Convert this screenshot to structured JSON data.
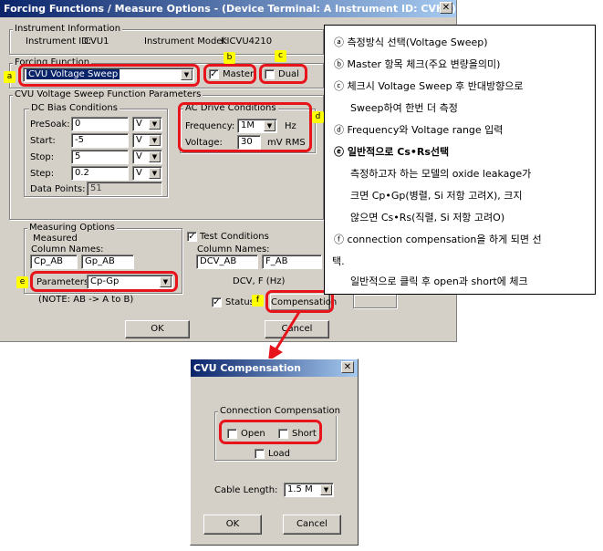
{
  "main_window": {
    "title": "Forcing Functions / Measure Options - (Device Terminal: A  Instrument ID: CVH1)",
    "close_glyph": "✕",
    "instrument_info": {
      "group_label": "Instrument Information",
      "id_label": "Instrument ID:",
      "id_value": "CVU1",
      "model_label": "Instrument Model:",
      "model_value": "KICVU4210"
    },
    "forcing_function": {
      "group_label": "Forcing Function",
      "selected": "CVU Voltage Sweep",
      "master_label": "Master",
      "master_checked": true,
      "dual_label": "Dual",
      "dual_checked": false
    },
    "params_group_label": "CVU Voltage Sweep Function Parameters",
    "dc_bias": {
      "group_label": "DC Bias Conditions",
      "rows": [
        {
          "label": "PreSoak:",
          "value": "0",
          "unit": "V"
        },
        {
          "label": "Start:",
          "value": "-5",
          "unit": "V"
        },
        {
          "label": "Stop:",
          "value": "5",
          "unit": "V"
        },
        {
          "label": "Step:",
          "value": "0.2",
          "unit": "V"
        }
      ],
      "points_label": "Data Points:",
      "points_value": "51"
    },
    "ac_drive": {
      "group_label": "AC Drive Conditions",
      "freq_label": "Frequency:",
      "freq_value": "1M",
      "freq_unit": "Hz",
      "volt_label": "Voltage:",
      "volt_value": "30",
      "volt_unit": "mV RMS"
    },
    "measuring": {
      "group_label": "Measuring Options",
      "measured_label": "Measured",
      "column_names_label": "Column Names:",
      "col1": "Cp_AB",
      "col2": "Gp_AB",
      "parameters_label": "Parameters:",
      "parameters_value": "Cp-Gp",
      "note": "(NOTE: AB -> A to B)"
    },
    "test_conditions": {
      "label": "Test Conditions",
      "checked": true,
      "column_names_label": "Column Names:",
      "col1": "DCV_AB",
      "col2": "F_AB",
      "units_text": "DCV, F (Hz)"
    },
    "status_label": "Status",
    "status_checked": true,
    "compensation_button": "Compensation",
    "ok_button": "OK",
    "cancel_button": "Cancel"
  },
  "markers": {
    "a": "a",
    "b": "b",
    "c": "c",
    "d": "d",
    "e": "e",
    "f": "f"
  },
  "notes": [
    "ⓐ  측정방식 선택(Voltage Sweep)",
    "ⓑ  Master 항목 체크(주요 변량을의미)",
    "ⓒ  체크시 Voltage Sweep 후 반대방향으로",
    "Sweep하여 한번 더 측정",
    "ⓓ  Frequency와 Voltage range 입력",
    "ⓔ  일반적으로 Cs•Rs선택",
    "측정하고자 하는 모델의 oxide leakage가",
    "크면 Cp•Gp(병렬, Si 저항 고려X), 크지",
    "않으면 Cs•Rs(직렬, Si 저항 고려O)",
    "ⓕ  connection compensation을 하게 되면 선",
    "택.",
    "일반적으로 클릭 후 open과 short에 체크"
  ],
  "compensation_dialog": {
    "title": "CVU Compensation",
    "close_glyph": "✕",
    "group_label": "Connection Compensation",
    "open_label": "Open",
    "short_label": "Short",
    "load_label": "Load",
    "cable_label": "Cable Length:",
    "cable_value": "1.5 M",
    "ok_button": "OK",
    "cancel_button": "Cancel"
  },
  "colors": {
    "highlight_red": "#e8141c",
    "marker_yellow": "#ffff00",
    "title_blue": "#0a246a",
    "dialog_gray": "#d4d0c8"
  }
}
